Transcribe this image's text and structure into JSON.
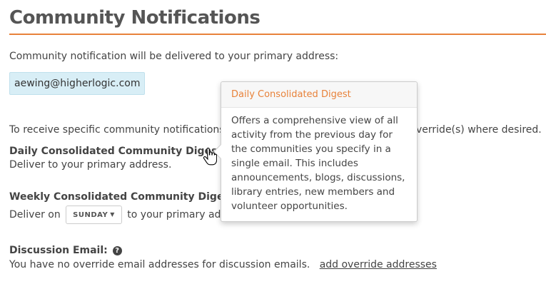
{
  "page": {
    "title": "Community Notifications"
  },
  "intro_text": "Community notification will be delivered to your primary address:",
  "primary_email": "aewing@higherlogic.com",
  "specific_text": "To receive specific community notifications at",
  "specific_text_tail": "verride(s) where desired.",
  "daily": {
    "label": "Daily Consolidated Community Digest:",
    "desc": "Deliver to your primary address."
  },
  "weekly": {
    "label": "Weekly Consolidated Community Digest:",
    "deliver_on": "Deliver on",
    "day": "SUNDAY",
    "tail": "to your primary addr"
  },
  "discussion": {
    "label": "Discussion Email:",
    "desc": "You have no override email addresses for discussion emails.",
    "link": "add override addresses"
  },
  "popover": {
    "title": "Daily Consolidated Digest",
    "body": "Offers a comprehensive view of all activity from the previous day for the communities you specify in a single email. This includes announcements, blogs, discussions, library entries, new members and volunteer opportunities."
  },
  "colors": {
    "accent": "#e8823a",
    "email_bg": "#d8eef6"
  }
}
